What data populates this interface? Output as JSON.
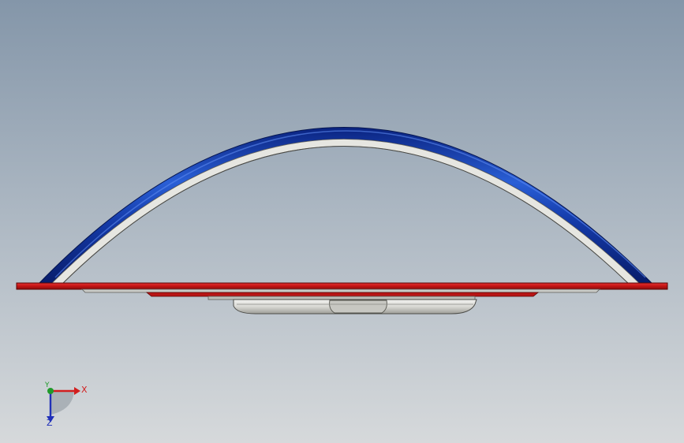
{
  "viewport": {
    "background_top": "#8496a9",
    "background_bottom": "#d6d9db"
  },
  "model": {
    "arch_color": "#1339a3",
    "inner_arch_color": "#e4e4e0",
    "base_plate_color": "#c81818",
    "housing_color": "#d9d9d5"
  },
  "triad": {
    "x_label": "X",
    "y_label": "Y",
    "z_label": "Z",
    "x_color": "#d21e1e",
    "y_color": "#1f9a2a",
    "z_color": "#2030b8"
  }
}
